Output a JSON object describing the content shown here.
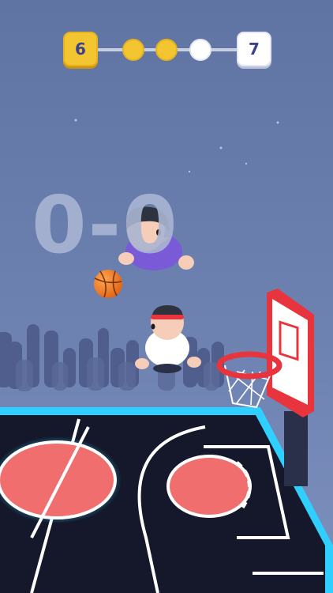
{
  "level": {
    "current": "6",
    "next": "7",
    "stages_completed": 2,
    "stages_total": 3
  },
  "score": {
    "text": "0-0"
  },
  "colors": {
    "sky": "#6a7fae",
    "court": "#14182a",
    "court_edge": "#2fd0ff",
    "accent_red": "#f06e6e",
    "gold": "#f2c531",
    "ball": "#f07a1e",
    "hoop_rim": "#e8343c"
  },
  "icons": [
    "basketball-icon",
    "player-purple-icon",
    "player-white-icon",
    "hoop-icon"
  ]
}
